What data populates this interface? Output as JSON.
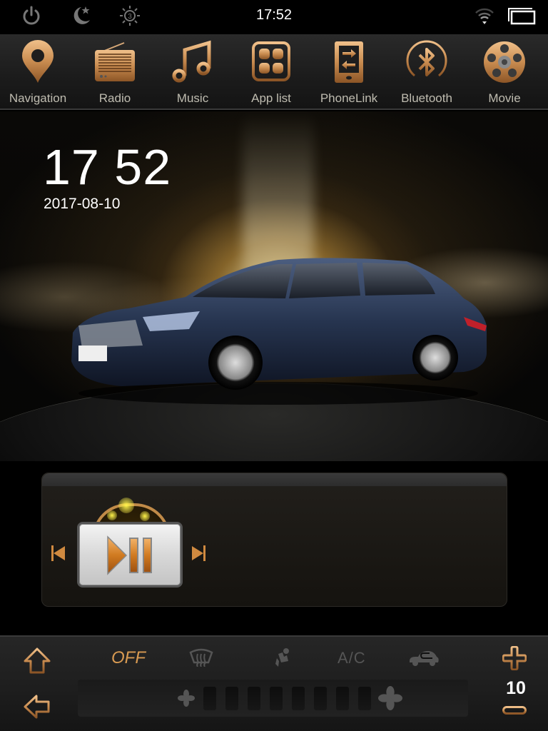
{
  "status_bar": {
    "time": "17:52",
    "icons": [
      "power-icon",
      "night-mode-icon",
      "brightness-icon",
      "wifi-icon",
      "recent-apps-icon"
    ],
    "brightness_level": "3"
  },
  "dock": {
    "items": [
      {
        "label": "Navigation",
        "icon": "map-pin-icon"
      },
      {
        "label": "Radio",
        "icon": "radio-icon"
      },
      {
        "label": "Music",
        "icon": "music-note-icon"
      },
      {
        "label": "App list",
        "icon": "app-grid-icon"
      },
      {
        "label": "PhoneLink",
        "icon": "phonelink-icon"
      },
      {
        "label": "Bluetooth",
        "icon": "bluetooth-icon"
      },
      {
        "label": "Movie",
        "icon": "film-reel-icon"
      }
    ]
  },
  "home": {
    "clock": "17 52",
    "date": "2017-08-10"
  },
  "media": {
    "controls": [
      "previous",
      "play-pause",
      "next"
    ]
  },
  "climate": {
    "status": "OFF",
    "ac_label": "A/C",
    "temperature": "10",
    "fan_level": 0,
    "fan_segments": 8
  },
  "colors": {
    "accent": "#d89a52",
    "icon_bronze": "#c98c50",
    "dock_label": "#bfbcb0",
    "inactive": "#555555"
  }
}
